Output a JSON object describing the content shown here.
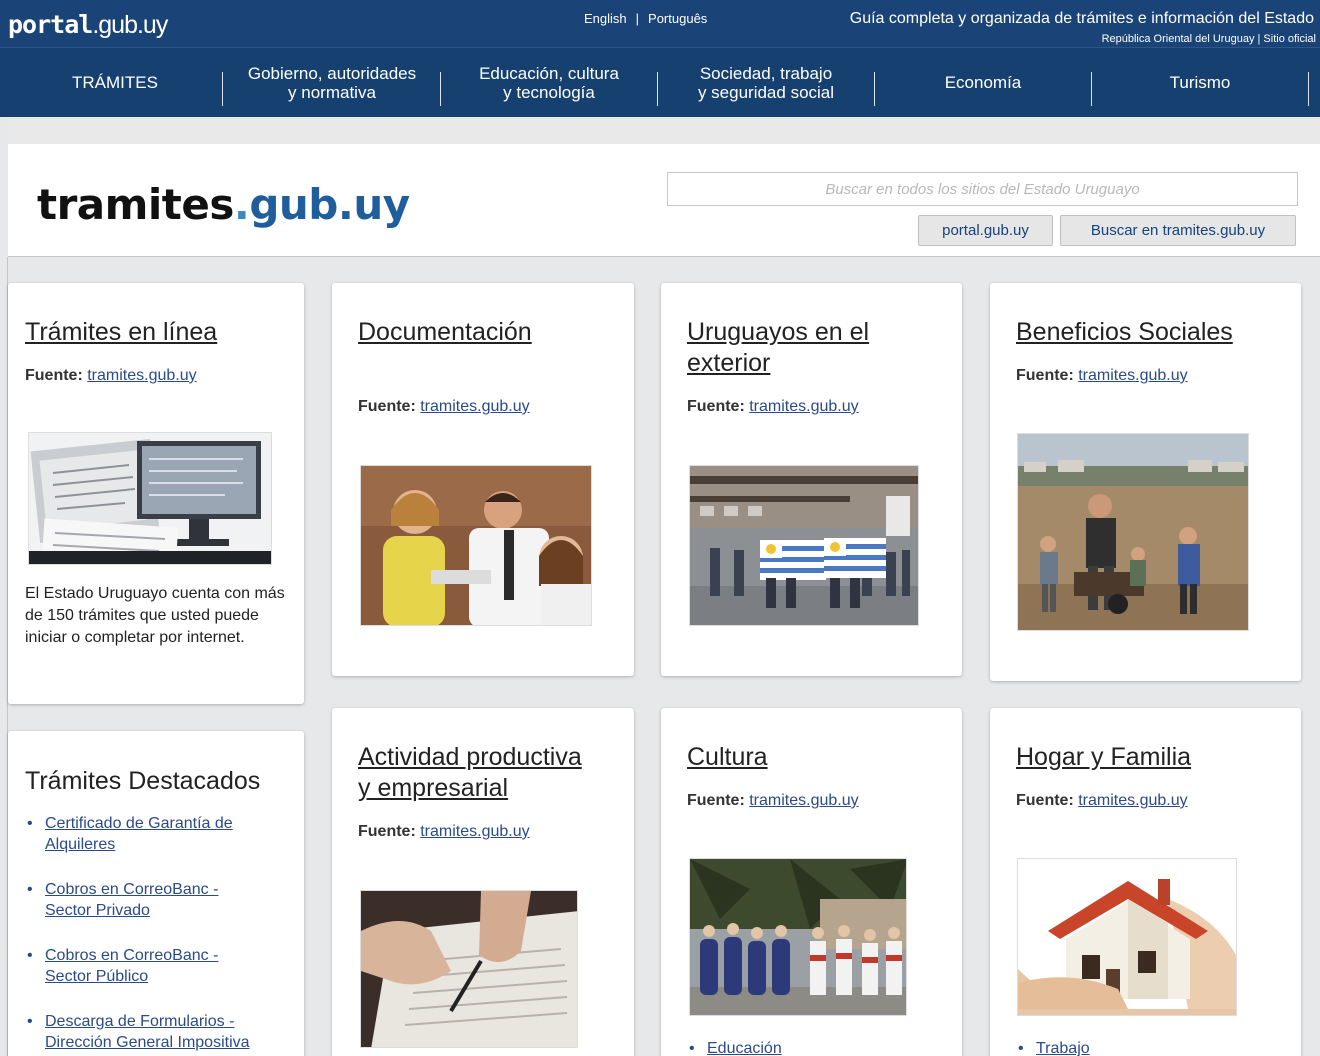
{
  "header": {
    "logo_bold": "portal",
    "logo_light": ".gub.uy",
    "lang_english": "English",
    "lang_separator": "|",
    "lang_portuguese": "Português",
    "tagline": "Guía completa y organizada de trámites e información del Estado",
    "subline": "República Oriental del Uruguay | Sitio oficial"
  },
  "nav": {
    "items": [
      {
        "line1": "TRÁMITES",
        "line2": ""
      },
      {
        "line1": "Gobierno, autoridades",
        "line2": "y normativa"
      },
      {
        "line1": "Educación, cultura",
        "line2": "y tecnología"
      },
      {
        "line1": "Sociedad, trabajo",
        "line2": "y seguridad social"
      },
      {
        "line1": "Economía",
        "line2": ""
      },
      {
        "line1": "Turismo",
        "line2": ""
      }
    ]
  },
  "site": {
    "logo_a": "tramites",
    "logo_dot": ".",
    "logo_b": "gub.uy",
    "search_placeholder": "Buscar en todos los sitios del Estado Uruguayo",
    "btn_portal": "portal.gub.uy",
    "btn_search": "Buscar en tramites.gub.uy"
  },
  "fuente_label": "Fuente:",
  "fuente_link": "tramites.gub.uy",
  "cards": {
    "tramites_linea": {
      "title": "Trámites en línea",
      "description": "El Estado Uruguayo cuenta con más de 150 trámites que usted puede iniciar o completar por internet."
    },
    "documentacion": {
      "title": "Documentación"
    },
    "uruguayos": {
      "title_line1": "Uruguayos en el",
      "title_line2": "exterior"
    },
    "beneficios": {
      "title": "Beneficios Sociales"
    },
    "actividad": {
      "title_line1": "Actividad productiva",
      "title_line2": "y empresarial"
    },
    "cultura": {
      "title": "Cultura",
      "list": [
        "Educación"
      ]
    },
    "hogar": {
      "title": "Hogar y Familia",
      "list": [
        "Trabajo"
      ]
    }
  },
  "destacados": {
    "title": "Trámites Destacados",
    "items": [
      {
        "line1": "Certificado de Garantía de",
        "line2": "Alquileres"
      },
      {
        "line1": "Cobros en CorreoBanc -",
        "line2": "Sector Privado"
      },
      {
        "line1": "Cobros en CorreoBanc -",
        "line2": "Sector Público"
      },
      {
        "line1": "Descarga de Formularios -",
        "line2": "Dirección General Impositiva"
      }
    ]
  }
}
